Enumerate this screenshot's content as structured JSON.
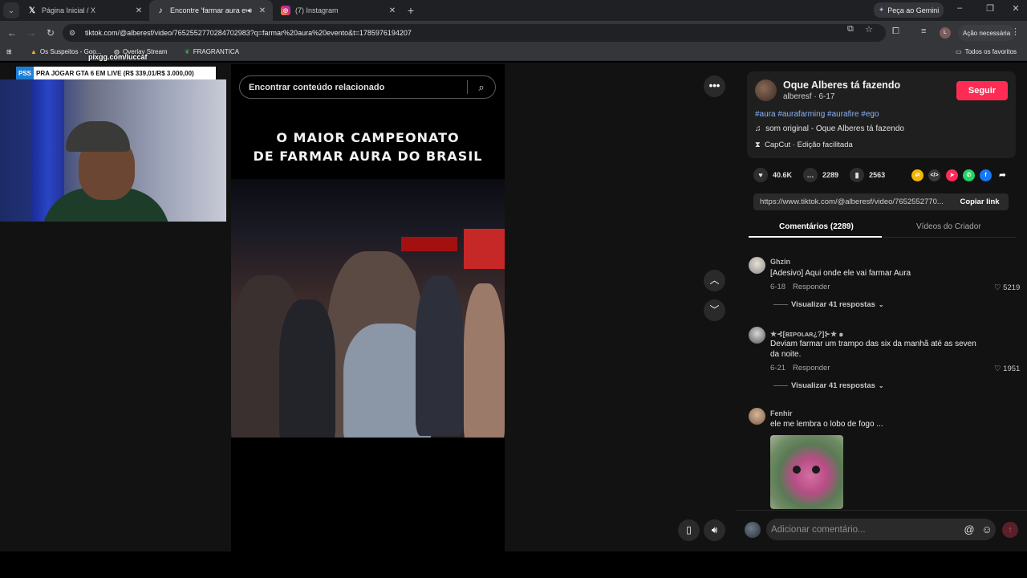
{
  "tabs": [
    {
      "title": "Página Inicial / X",
      "favicon": "x-icon"
    },
    {
      "title": "Encontre 'farmar aura evento'",
      "favicon": "tiktok-icon",
      "active": true
    },
    {
      "title": "(7) Instagram",
      "favicon": "instagram-icon"
    }
  ],
  "gemini_button": "Peça ao Gemini",
  "address": "tiktok.com/@alberesf/video/7652552770284702983?q=farmar%20aura%20evento&t=1785976194207",
  "action_needed": "Ação necessária",
  "profile_initial": "L",
  "bookmarks": [
    "Os Suspeitos - Goo...",
    "Overlay Stream",
    "FRAGRANTICA"
  ],
  "all_bookmarks": "Todos os favoritos",
  "stream_overlay": {
    "pix_text": "pixgg.com/luccaf",
    "banner_tag": "PSS",
    "banner_text": "PRA JOGAR GTA 6 EM LIVE (R$ 339,01/R$ 3.000,00)"
  },
  "video": {
    "search_placeholder": "Encontrar conteúdo relacionado",
    "caption_line1": "O MAIOR CAMPEONATO",
    "caption_line2": "DE FARMAR AURA DO BRASIL"
  },
  "post": {
    "author_name": "Oque Alberes tá fazendo",
    "author_meta": "alberesf · 6-17",
    "follow_label": "Seguir",
    "hashtags": "#aura #aurafarming #aurafire #ego",
    "sound": "som original - Oque Alberes tá fazendo",
    "capcut": "CapCut · Edição facilitada",
    "likes": "40.6K",
    "comments": "2289",
    "saves": "2563",
    "link": "https://www.tiktok.com/@alberesf/video/7652552770...",
    "copy_label": "Copiar link"
  },
  "panel_tabs": [
    "Comentários (2289)",
    "Vídeos do Criador"
  ],
  "comments": [
    {
      "user": "Ghzin",
      "text": "[Adesivo] Aqui onde ele vai farmar Aura",
      "date": "6-18",
      "reply": "Responder",
      "likes": "5219",
      "view_replies": "Visualizar 41 respostas"
    },
    {
      "user": "★⊰[ʙɪᴘᴏʟᴀʀ¿?]⊱★ ๑",
      "text_line1": "Deviam farmar um trampo das six da manhã até as seven",
      "text_line2": "da noite.",
      "date": "6-21",
      "reply": "Responder",
      "likes": "1951",
      "view_replies": "Visualizar 41 respostas"
    },
    {
      "user": "Fenhir",
      "text": "ele me lembra o lobo de fogo ..."
    }
  ],
  "comment_input_placeholder": "Adicionar comentário...",
  "colors": {
    "accent": "#fe2c55",
    "link": "#8ab4f8"
  }
}
